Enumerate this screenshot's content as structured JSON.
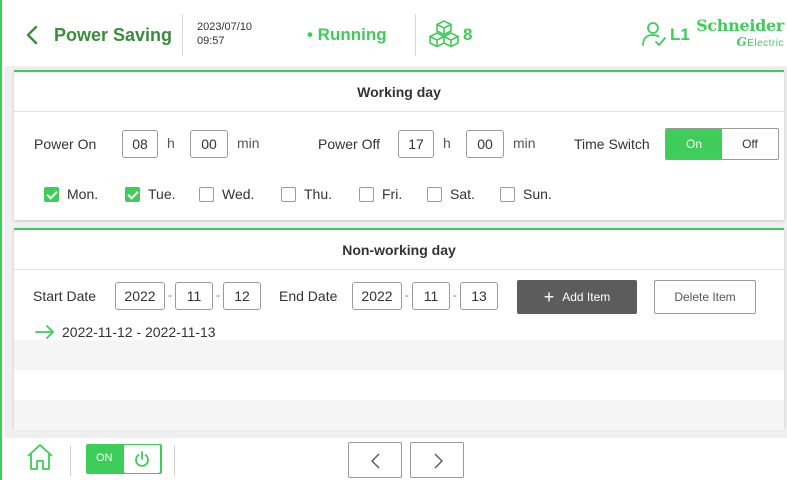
{
  "header": {
    "title": "Power Saving",
    "date": "2023/07/10",
    "time": "09:57",
    "status": "• Running",
    "device_count": "8",
    "user_level": "L1",
    "logo_line1": "Schneider",
    "logo_line2_mark": "G",
    "logo_line2_text": "Electric",
    "icons": [
      "chevron-left-icon",
      "cubes-icon",
      "user-check-icon"
    ]
  },
  "working_day": {
    "title": "Working day",
    "power_on_label": "Power On",
    "power_on_hour": "08",
    "power_on_min": "00",
    "power_off_label": "Power Off",
    "power_off_hour": "17",
    "power_off_min": "00",
    "hour_unit": "h",
    "min_unit": "min",
    "time_switch_label": "Time Switch",
    "time_switch_on": "On",
    "time_switch_off": "Off",
    "time_switch_value": "On",
    "days": [
      {
        "label": "Mon.",
        "checked": true
      },
      {
        "label": "Tue.",
        "checked": true
      },
      {
        "label": "Wed.",
        "checked": false
      },
      {
        "label": "Thu.",
        "checked": false
      },
      {
        "label": "Fri.",
        "checked": false
      },
      {
        "label": "Sat.",
        "checked": false
      },
      {
        "label": "Sun.",
        "checked": false
      }
    ]
  },
  "non_working_day": {
    "title": "Non-working day",
    "start_label": "Start Date",
    "start_year": "2022",
    "start_month": "11",
    "start_day": "12",
    "end_label": "End Date",
    "end_year": "2022",
    "end_month": "11",
    "end_day": "13",
    "date_sep": "-",
    "add_label": "Add Item",
    "delete_label": "Delete Item",
    "items": [
      "2022-11-12 - 2022-11-13"
    ]
  },
  "footer": {
    "power_label": "ON",
    "power_state": "on",
    "icons": [
      "home-icon",
      "power-icon",
      "chevron-left-icon",
      "chevron-right-icon"
    ]
  },
  "colors": {
    "accent": "#3dcd58",
    "title_green": "#3a8d3a",
    "button_dark": "#5c5c5c",
    "background": "#f0f0f0"
  }
}
